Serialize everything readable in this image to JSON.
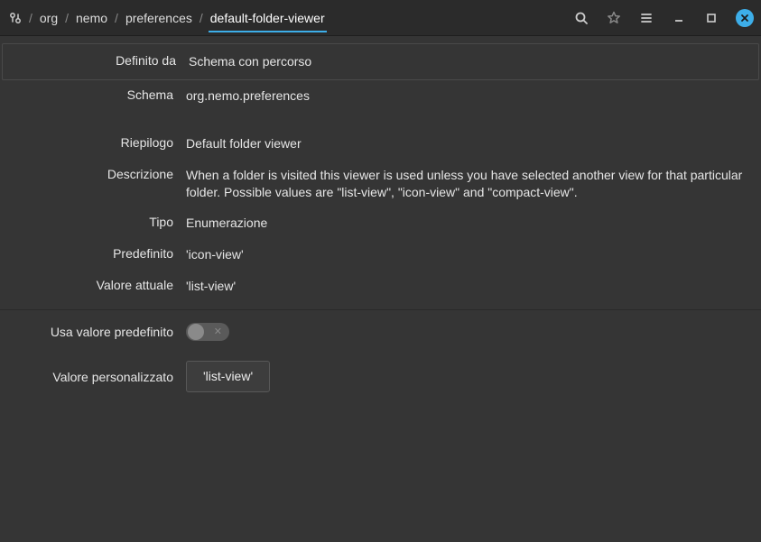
{
  "breadcrumb": {
    "items": [
      "org",
      "nemo",
      "preferences",
      "default-folder-viewer"
    ]
  },
  "rows": {
    "definedBy": {
      "label": "Definito da",
      "value": "Schema con percorso"
    },
    "schema": {
      "label": "Schema",
      "value": "org.nemo.preferences"
    },
    "summary": {
      "label": "Riepilogo",
      "value": "Default folder viewer"
    },
    "description": {
      "label": "Descrizione",
      "value": "When a folder is visited this viewer is used unless you have selected another view for that particular folder. Possible values are \"list-view\", \"icon-view\" and \"compact-view\"."
    },
    "type": {
      "label": "Tipo",
      "value": "Enumerazione"
    },
    "default": {
      "label": "Predefinito",
      "value": "'icon-view'"
    },
    "current": {
      "label": "Valore attuale",
      "value": "'list-view'"
    },
    "useDefault": {
      "label": "Usa valore predefinito"
    },
    "custom": {
      "label": "Valore personalizzato",
      "value": "'list-view'"
    }
  },
  "toggle": {
    "state": "off"
  }
}
